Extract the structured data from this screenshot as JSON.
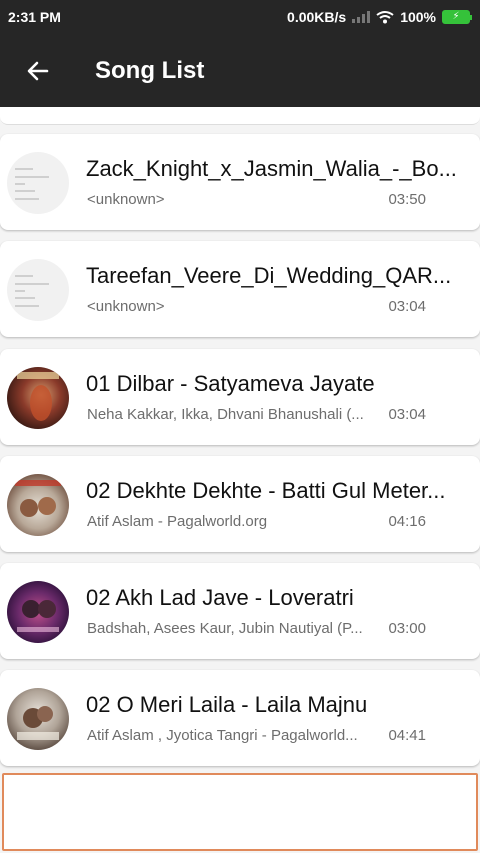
{
  "status_bar": {
    "time": "2:31 PM",
    "network_speed": "0.00KB/s",
    "battery": "100%"
  },
  "app_bar": {
    "title": "Song List",
    "back_icon": "arrow-left-icon"
  },
  "songs": [
    {
      "title": "Zack_Knight_x_Jasmin_Walia_-_Bo...",
      "artist": "<unknown>",
      "duration": "03:50",
      "thumb": "doc"
    },
    {
      "title": "Tareefan_Veere_Di_Wedding_QAR...",
      "artist": "<unknown>",
      "duration": "03:04",
      "thumb": "doc"
    },
    {
      "title": "01 Dilbar - Satyameva Jayate",
      "artist": "Neha Kakkar, Ikka, Dhvani Bhanushali (...",
      "duration": "03:04",
      "thumb": "art"
    },
    {
      "title": "02 Dekhte Dekhte - Batti Gul Meter...",
      "artist": "Atif Aslam - Pagalworld.org",
      "duration": "04:16",
      "thumb": "art"
    },
    {
      "title": "02 Akh Lad Jave - Loveratri",
      "artist": "Badshah, Asees Kaur, Jubin Nautiyal (P...",
      "duration": "03:00",
      "thumb": "art"
    },
    {
      "title": "02 O Meri Laila - Laila Majnu",
      "artist": "Atif Aslam , Jyotica Tangri - Pagalworld...",
      "duration": "04:41",
      "thumb": "art"
    }
  ],
  "colors": {
    "app_bar": "#262626",
    "placeholder_border": "#e08a5b",
    "battery": "#35c23a"
  }
}
